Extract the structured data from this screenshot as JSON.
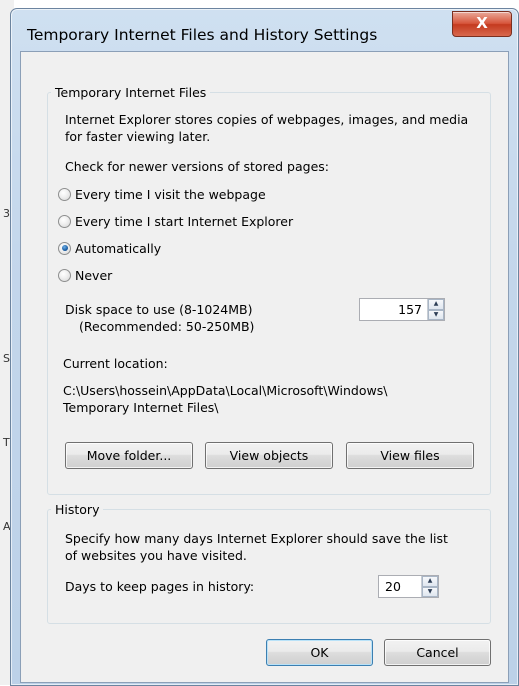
{
  "dialog": {
    "title": "Temporary Internet Files and History Settings",
    "close_label": "X"
  },
  "temp_files": {
    "legend": "Temporary Internet Files",
    "description_line1": "Internet Explorer stores copies of webpages, images, and media",
    "description_line2": "for faster viewing later.",
    "check_label": "Check for newer versions of stored pages:",
    "options": [
      {
        "label": "Every time I visit the webpage",
        "checked": false
      },
      {
        "label": "Every time I start Internet Explorer",
        "checked": false
      },
      {
        "label": "Automatically",
        "checked": true
      },
      {
        "label": "Never",
        "checked": false
      }
    ],
    "disk_label_line1": "Disk space to use (8-1024MB)",
    "disk_label_line2": "(Recommended: 50-250MB)",
    "disk_value": "157",
    "location_label": "Current location:",
    "location_line1": "C:\\Users\\hossein\\AppData\\Local\\Microsoft\\Windows\\",
    "location_line2": "Temporary Internet Files\\",
    "buttons": {
      "move": "Move folder...",
      "view_objects": "View objects",
      "view_files": "View files"
    }
  },
  "history": {
    "legend": "History",
    "description_line1": "Specify how many days Internet Explorer should save the list",
    "description_line2": "of websites you have visited.",
    "days_label": "Days to keep pages in history:",
    "days_value": "20"
  },
  "footer": {
    "ok": "OK",
    "cancel": "Cancel"
  },
  "background_edge_marks": [
    "3",
    "S",
    "T",
    "A"
  ]
}
